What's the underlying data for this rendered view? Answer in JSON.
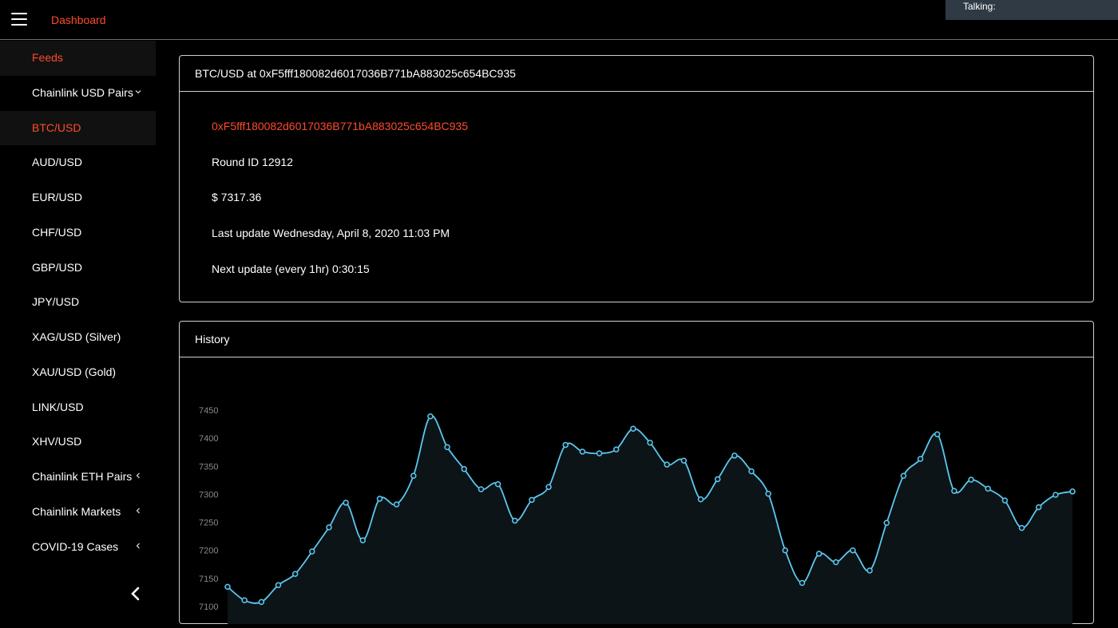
{
  "header": {
    "brand": "Dashboard",
    "talking_label": "Talking:"
  },
  "sidebar": {
    "items": [
      {
        "label": "Feeds",
        "active": true,
        "chevron": ""
      },
      {
        "label": "Chainlink USD Pairs",
        "active": false,
        "chevron": "chevron-down"
      },
      {
        "label": "BTC/USD",
        "active": true,
        "chevron": ""
      },
      {
        "label": "AUD/USD",
        "active": false,
        "chevron": ""
      },
      {
        "label": "EUR/USD",
        "active": false,
        "chevron": ""
      },
      {
        "label": "CHF/USD",
        "active": false,
        "chevron": ""
      },
      {
        "label": "GBP/USD",
        "active": false,
        "chevron": ""
      },
      {
        "label": "JPY/USD",
        "active": false,
        "chevron": ""
      },
      {
        "label": "XAG/USD (Silver)",
        "active": false,
        "chevron": ""
      },
      {
        "label": "XAU/USD (Gold)",
        "active": false,
        "chevron": ""
      },
      {
        "label": "LINK/USD",
        "active": false,
        "chevron": ""
      },
      {
        "label": "XHV/USD",
        "active": false,
        "chevron": ""
      },
      {
        "label": "Chainlink ETH Pairs",
        "active": false,
        "chevron": "chevron-left"
      },
      {
        "label": "Chainlink Markets",
        "active": false,
        "chevron": "chevron-left"
      },
      {
        "label": "COVID-19 Cases",
        "active": false,
        "chevron": "chevron-left"
      }
    ]
  },
  "feed": {
    "title": "BTC/USD at 0xF5fff180082d6017036B771bA883025c654BC935",
    "address": "0xF5fff180082d6017036B771bA883025c654BC935",
    "round_id": "Round ID 12912",
    "price": "$ 7317.36",
    "last_update": "Last update Wednesday, April 8, 2020 11:03 PM",
    "next_update": "Next update (every 1hr) 0:30:15"
  },
  "history": {
    "title": "History"
  },
  "colors": {
    "accent": "#ff4b2b",
    "line": "#5bc8f0",
    "area": "#0c1417",
    "header_bg": "#2f3a45"
  },
  "chart_data": {
    "type": "area",
    "title": "",
    "xlabel": "",
    "ylabel": "",
    "ylim": [
      7100,
      7460
    ],
    "yticks": [
      7100,
      7150,
      7200,
      7250,
      7300,
      7350,
      7400,
      7450
    ],
    "grid": false,
    "series": [
      {
        "values": [
          7135,
          7111,
          7108,
          7138,
          7158,
          7198,
          7241,
          7285,
          7218,
          7292,
          7282,
          7333,
          7439,
          7384,
          7345,
          7309,
          7318,
          7253,
          7290,
          7313,
          7388,
          7376,
          7373,
          7380,
          7417,
          7392,
          7353,
          7360,
          7291,
          7327,
          7369,
          7341,
          7301,
          7200,
          7142,
          7194,
          7179,
          7200,
          7164,
          7249,
          7333,
          7363,
          7407,
          7306,
          7326,
          7310,
          7289,
          7240,
          7277,
          7299,
          7305
        ]
      }
    ]
  }
}
